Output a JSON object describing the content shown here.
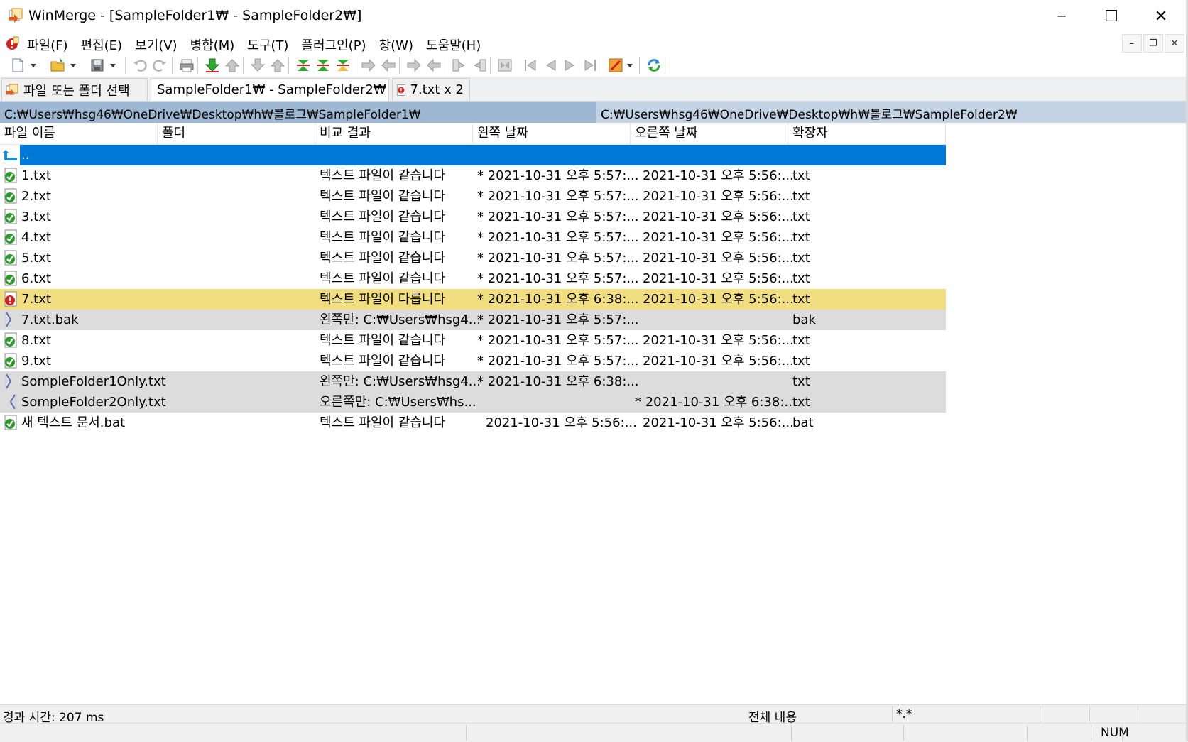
{
  "window": {
    "title": "WinMerge - [SampleFolder1₩ - SampleFolder2₩]",
    "minimize_glyph": "─",
    "maximize_glyph": "☐",
    "close_glyph": "✕"
  },
  "menu": {
    "items": [
      "파일(F)",
      "편집(E)",
      "보기(V)",
      "병합(M)",
      "도구(T)",
      "플러그인(P)",
      "창(W)",
      "도움말(H)"
    ],
    "mdi_minimize": "–",
    "mdi_restore": "❐",
    "mdi_close": "✕"
  },
  "toolbar": {
    "icons": [
      "new-document",
      "dropdown",
      "open-folder",
      "dropdown",
      "save",
      "dropdown",
      "undo",
      "redo",
      "print",
      "copy-to-right",
      "copy-to-left",
      "copy-right-advance",
      "copy-left-advance",
      "next-diff",
      "prev-diff",
      "current-diff",
      "copy-right",
      "copy-left",
      "copy-all-right",
      "copy-all-left",
      "first-file",
      "last-file",
      "expand",
      "first-diff",
      "prev-diff-file",
      "next-diff-file",
      "last-diff-file",
      "plugin-options",
      "dropdown",
      "refresh"
    ]
  },
  "tabs": [
    {
      "label": "파일 또는 폴더 선택",
      "icon": "open-folder-icon"
    },
    {
      "label": "SampleFolder1₩ - SampleFolder2₩",
      "icon": "winmerge-icon"
    },
    {
      "label": "7.txt x 2",
      "icon": "file-diff-icon"
    }
  ],
  "paths": {
    "left": "C:₩Users₩hsg46₩OneDrive₩Desktop₩h₩블로그₩SampleFolder1₩",
    "right": "C:₩Users₩hsg46₩OneDrive₩Desktop₩h₩블로그₩SampleFolder2₩"
  },
  "columns": [
    "파일 이름",
    "폴더",
    "비교 결과",
    "왼쪽 날짜",
    "오른쪽 날짜",
    "확장자"
  ],
  "rows": [
    {
      "name": "..",
      "folder": "",
      "result": "",
      "left_date": "",
      "right_date": "",
      "ext": "",
      "status": "parent"
    },
    {
      "name": "1.txt",
      "folder": "",
      "result": "텍스트 파일이 같습니다",
      "left_date": "* 2021-10-31 오후 5:57:...",
      "right_date": "2021-10-31 오후 5:56:...",
      "ext": "txt",
      "status": "same"
    },
    {
      "name": "2.txt",
      "folder": "",
      "result": "텍스트 파일이 같습니다",
      "left_date": "* 2021-10-31 오후 5:57:...",
      "right_date": "2021-10-31 오후 5:56:...",
      "ext": "txt",
      "status": "same"
    },
    {
      "name": "3.txt",
      "folder": "",
      "result": "텍스트 파일이 같습니다",
      "left_date": "* 2021-10-31 오후 5:57:...",
      "right_date": "2021-10-31 오후 5:56:...",
      "ext": "txt",
      "status": "same"
    },
    {
      "name": "4.txt",
      "folder": "",
      "result": "텍스트 파일이 같습니다",
      "left_date": "* 2021-10-31 오후 5:57:...",
      "right_date": "2021-10-31 오후 5:56:...",
      "ext": "txt",
      "status": "same"
    },
    {
      "name": "5.txt",
      "folder": "",
      "result": "텍스트 파일이 같습니다",
      "left_date": "* 2021-10-31 오후 5:57:...",
      "right_date": "2021-10-31 오후 5:56:...",
      "ext": "txt",
      "status": "same"
    },
    {
      "name": "6.txt",
      "folder": "",
      "result": "텍스트 파일이 같습니다",
      "left_date": "* 2021-10-31 오후 5:57:...",
      "right_date": "2021-10-31 오후 5:56:...",
      "ext": "txt",
      "status": "same"
    },
    {
      "name": "7.txt",
      "folder": "",
      "result": "텍스트 파일이 다릅니다",
      "left_date": "* 2021-10-31 오후 6:38:...",
      "right_date": "2021-10-31 오후 5:56:...",
      "ext": "txt",
      "status": "diff"
    },
    {
      "name": "7.txt.bak",
      "folder": "",
      "result": "왼쪽만: C:₩Users₩hsg4...",
      "left_date": "* 2021-10-31 오후 5:57:...",
      "right_date": "",
      "ext": "bak",
      "status": "left-only"
    },
    {
      "name": "8.txt",
      "folder": "",
      "result": "텍스트 파일이 같습니다",
      "left_date": "* 2021-10-31 오후 5:57:...",
      "right_date": "2021-10-31 오후 5:56:...",
      "ext": "txt",
      "status": "same"
    },
    {
      "name": "9.txt",
      "folder": "",
      "result": "텍스트 파일이 같습니다",
      "left_date": "* 2021-10-31 오후 5:57:...",
      "right_date": "2021-10-31 오후 5:56:...",
      "ext": "txt",
      "status": "same"
    },
    {
      "name": "SompleFolder1Only.txt",
      "folder": "",
      "result": "왼쪽만: C:₩Users₩hsg4...",
      "left_date": "* 2021-10-31 오후 6:38:...",
      "right_date": "",
      "ext": "txt",
      "status": "left-only"
    },
    {
      "name": "SompleFolder2Only.txt",
      "folder": "",
      "result": "오른쪽만: C:₩Users₩hs...",
      "left_date": "",
      "right_date": "* 2021-10-31 오후 6:38:...",
      "ext": "txt",
      "status": "right-only"
    },
    {
      "name": "새 텍스트 문서.bat",
      "folder": "",
      "result": "텍스트 파일이 같습니다",
      "left_date": "2021-10-31 오후 5:56:...",
      "right_date": "2021-10-31 오후 5:56:...",
      "ext": "bat",
      "status": "same"
    }
  ],
  "status": {
    "elapsed": "경과 시간: 207 ms",
    "compare_method": "전체 내용",
    "filter": "*.*",
    "num": "NUM"
  },
  "colors": {
    "selection": "#0078d7",
    "diff_row": "#f0de80",
    "unique_row": "#dcdcdc",
    "path_left": "#9eb8d3",
    "path_right": "#c4d3e3"
  }
}
